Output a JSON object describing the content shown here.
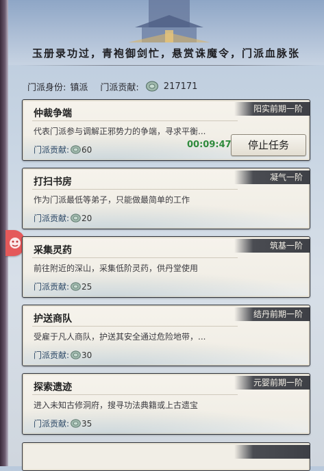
{
  "header": {
    "headline": "玉册录功过，青袍御剑忙，悬赏诛魔令，门派血脉张"
  },
  "status": {
    "identity_label": "门派身份:",
    "identity_value": "镇派",
    "contribution_label": "门派贡献:",
    "contribution_value": "217171",
    "coin_icon": "jade-coin-icon"
  },
  "colors": {
    "side_tab": "#e4595a",
    "timer": "#2e8a3c",
    "rank_tag_bg": "#3e4046"
  },
  "reward_label": "门派贡献:",
  "tasks": [
    {
      "title": "仲裁争端",
      "rank": "阳实前期一阶",
      "desc": "代表门派参与调解正邪势力的争端，寻求平衡...",
      "reward": "60",
      "timer": "00:09:47",
      "action": "停止任务"
    },
    {
      "title": "打扫书房",
      "rank": "凝气一阶",
      "desc": "作为门派最低等弟子，只能做最简单的工作",
      "reward": "20"
    },
    {
      "title": "采集灵药",
      "rank": "筑基一阶",
      "desc": "前往附近的深山，采集低阶灵药，供丹堂使用",
      "reward": "25"
    },
    {
      "title": "护送商队",
      "rank": "结丹前期一阶",
      "desc": "受雇于凡人商队，护送其安全通过危险地带，...",
      "reward": "30"
    },
    {
      "title": "探索遗迹",
      "rank": "元婴前期一阶",
      "desc": "进入未知古修洞府，搜寻功法典籍或上古遗宝",
      "reward": "35"
    }
  ]
}
